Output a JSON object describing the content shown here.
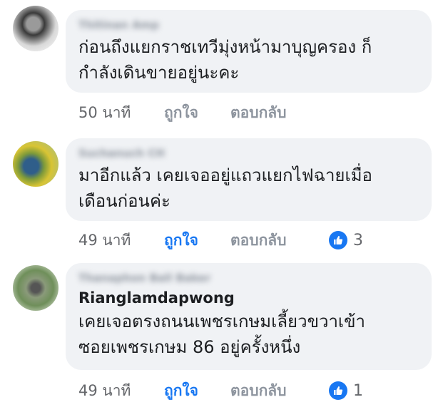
{
  "comments": [
    {
      "name": "Thitinan Amp",
      "text": "ก่อนถึงแยกราชเทวีมุ่งหน้ามาบุญครอง ก็\nกำลังเดินขายอยู่นะคะ",
      "mention": "",
      "time": "50 นาที",
      "like_label": "ถูกใจ",
      "liked": false,
      "reply_label": "ตอบกลับ",
      "reaction_count": ""
    },
    {
      "name": "Suchanuch CH",
      "text": "มาอีกแล้ว เคยเจออยู่แถวแยกไฟฉายเมื่อ\nเดือนก่อนค่ะ",
      "mention": "",
      "time": "49 นาที",
      "like_label": "ถูกใจ",
      "liked": true,
      "reply_label": "ตอบกลับ",
      "reaction_count": "3"
    },
    {
      "name": "Thanaphon Ball Baker",
      "text": "เคยเจอตรงถนนเพชรเกษมเลี้ยวขวาเข้า\nซอยเพชรเกษม 86 อยู่ครั้งหนึ่ง",
      "mention": "Rianglamdapwong",
      "time": "49 นาที",
      "like_label": "ถูกใจ",
      "liked": true,
      "reply_label": "ตอบกลับ",
      "reaction_count": "1"
    }
  ],
  "colors": {
    "bubble": "#f0f2f5",
    "text": "#1c1e21",
    "meta": "#65676b",
    "liked": "#1877f2"
  },
  "icons": {
    "reaction": "thumbs-up-icon"
  }
}
